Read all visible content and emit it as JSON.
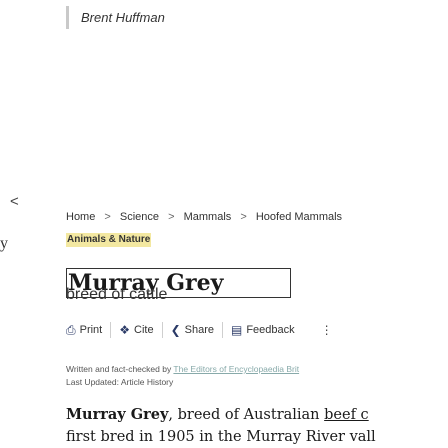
{
  "author": "Brent Huffman",
  "sidebar": {
    "chevron": "<",
    "fragment": "y"
  },
  "breadcrumb": [
    "Home",
    "Science",
    "Mammals",
    "Hoofed Mammals"
  ],
  "breadcrumb_separator": ">",
  "topic_badge": "Animals & Nature",
  "article": {
    "title": "Murray Grey",
    "subtitle": "breed of cattle",
    "credits": {
      "written_prefix": "Written and fact-checked by",
      "written_link": "The Editors of Encyclopaedia Brit",
      "last_updated_label": "Last Updated:",
      "article_history": "Article History"
    },
    "body": {
      "lead_bold": "Murray Grey",
      "line1_rest": ", breed of Australian",
      "line1_link": "beef c",
      "line2": "first bred in 1905 in the Murray River vall"
    }
  },
  "toolbar": {
    "print": "Print",
    "cite": "Cite",
    "share": "Share",
    "feedback": "Feedback",
    "more": "⋮"
  },
  "icons": {
    "print": "printer-icon",
    "cite": "cite-icon",
    "share": "share-icon",
    "feedback": "feedback-icon"
  },
  "colors": {
    "badge_bg": "#f3e8a1",
    "icon_color": "#2b3a67"
  }
}
